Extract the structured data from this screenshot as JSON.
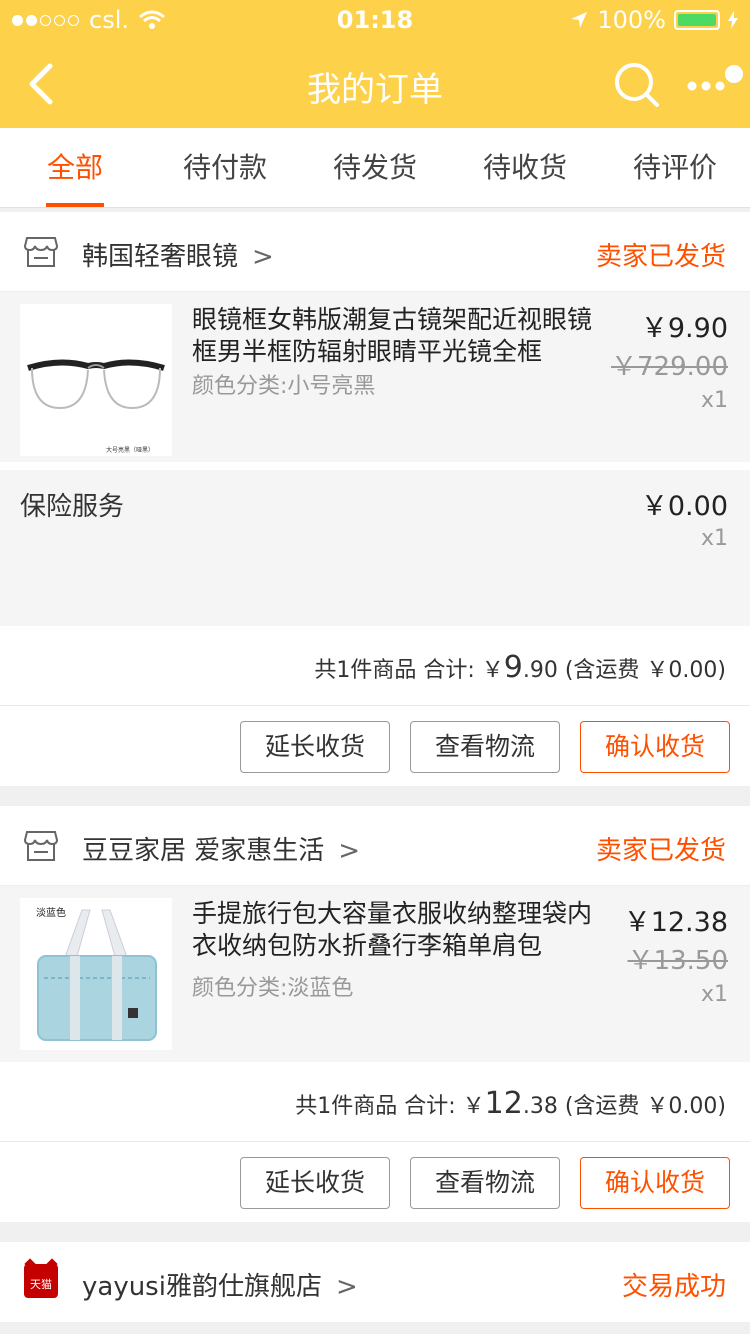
{
  "status": {
    "carrier": "csl.",
    "time": "01:18",
    "battery": "100%"
  },
  "nav": {
    "title": "我的订单"
  },
  "tabs": [
    "全部",
    "待付款",
    "待发货",
    "待收货",
    "待评价"
  ],
  "orders": [
    {
      "shop": "韩国轻奢眼镜",
      "status": "卖家已发货",
      "item": {
        "title": "眼镜框女韩版潮复古镜架配近视眼镜框男半框防辐射眼睛平光镜全框",
        "sku": "颜色分类:小号亮黑",
        "price": "￥9.90",
        "old_price": "￥729.00",
        "qty": "x1",
        "thumb_caption": "大号亮黑（哑黑）"
      },
      "insurance": {
        "label": "保险服务",
        "price": "￥0.00",
        "qty": "x1"
      },
      "total": {
        "prefix": "共1件商品 合计: ￥",
        "big": "9",
        "small": ".90",
        "suffix": " (含运费 ￥0.00)"
      },
      "buttons": [
        "延长收货",
        "查看物流",
        "确认收货"
      ]
    },
    {
      "shop": "豆豆家居 爱家惠生活",
      "status": "卖家已发货",
      "item": {
        "title": "手提旅行包大容量衣服收纳整理袋内衣收纳包防水折叠行李箱单肩包",
        "sku": "颜色分类:淡蓝色",
        "price": "￥12.38",
        "old_price": "￥13.50",
        "qty": "x1",
        "thumb_caption": "淡蓝色"
      },
      "total": {
        "prefix": "共1件商品 合计: ￥",
        "big": "12",
        "small": ".38",
        "suffix": " (含运费 ￥0.00)"
      },
      "buttons": [
        "延长收货",
        "查看物流",
        "确认收货"
      ]
    },
    {
      "shop": "yayusi雅韵仕旗舰店",
      "status": "交易成功",
      "badge": "天猫"
    }
  ],
  "colors": {
    "brand_yellow": "#fdd24a",
    "accent_orange": "#ff5000"
  }
}
